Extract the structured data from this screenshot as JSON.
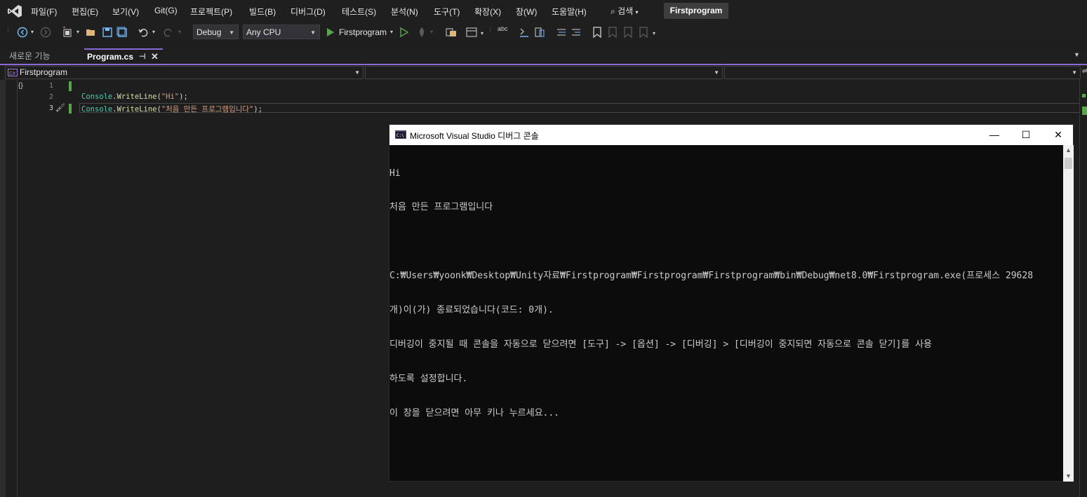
{
  "menu": {
    "items": [
      "파일(F)",
      "편집(E)",
      "보기(V)",
      "Git(G)",
      "프로젝트(P)",
      "빌드(B)",
      "디버그(D)",
      "테스트(S)",
      "분석(N)",
      "도구(T)",
      "확장(X)",
      "창(W)",
      "도움말(H)"
    ],
    "search_label": "검색",
    "solution_title": "Firstprogram"
  },
  "toolbar": {
    "config": "Debug",
    "platform": "Any CPU",
    "run_target": "Firstprogram"
  },
  "tabs": [
    {
      "label": "새로운 기능",
      "active": false
    },
    {
      "label": "Program.cs",
      "active": true,
      "pin_icon": "pin-icon",
      "close_icon": "close-icon"
    }
  ],
  "navbar": {
    "project": "Firstprogram"
  },
  "code": {
    "lines": [
      {
        "number": "1",
        "text": ""
      },
      {
        "number": "2",
        "class_tok": "Console",
        "method_tok": "WriteLine",
        "string_tok": "\"Hi\""
      },
      {
        "number": "3",
        "class_tok": "Console",
        "method_tok": "WriteLine",
        "string_tok": "\"처음 만든 프로그램입니다\""
      }
    ]
  },
  "console": {
    "title": "Microsoft Visual Studio 디버그 콘솔",
    "lines": [
      "Hi",
      "처음 만든 프로그램입니다",
      "",
      "C:₩Users₩yoonk₩Desktop₩Unity자료₩Firstprogram₩Firstprogram₩Firstprogram₩bin₩Debug₩net8.0₩Firstprogram.exe(프로세스 29628",
      "개)이(가) 종료되었습니다(코드: 0개).",
      "디버깅이 중지될 때 콘솔을 자동으로 닫으려면 [도구] -> [옵션] -> [디버깅] > [디버깅이 중지되면 자동으로 콘솔 닫기]를 사용",
      "하도록 설정합니다.",
      "이 창을 닫으려면 아무 키나 누르세요..."
    ]
  },
  "colors": {
    "accent": "#8b6ad6",
    "run_green": "#57a64a",
    "class_token": "#4ec9b0",
    "string_token": "#d69d85"
  }
}
